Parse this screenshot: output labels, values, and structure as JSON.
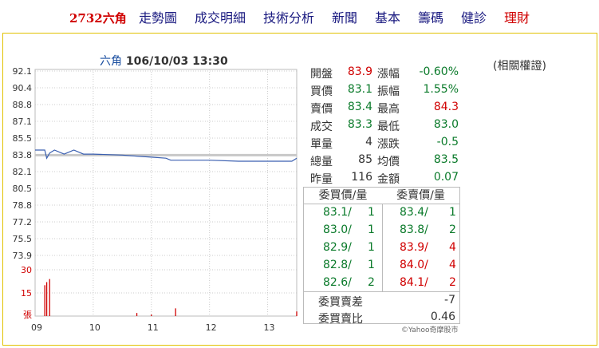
{
  "nav": {
    "stock": "2732六角",
    "items": [
      "走勢圖",
      "成交明細",
      "技術分析",
      "新聞",
      "基本",
      "籌碼",
      "健診"
    ],
    "finance": "理財"
  },
  "chart": {
    "name": "六角",
    "datetime": "106/10/03 13:30",
    "y_ticks": [
      "92.1",
      "90.4",
      "88.8",
      "87.1",
      "85.5",
      "83.8",
      "82.1",
      "80.5",
      "78.8",
      "77.2",
      "75.5",
      "73.9"
    ],
    "vol_ticks": [
      "30",
      "15",
      "張"
    ],
    "x_ticks": [
      "09",
      "10",
      "11",
      "12",
      "13"
    ]
  },
  "chart_data": {
    "type": "line",
    "x": [
      "09:00",
      "09:10",
      "09:12",
      "09:15",
      "09:20",
      "09:30",
      "09:40",
      "09:50",
      "10:00",
      "10:30",
      "10:45",
      "11:00",
      "11:15",
      "11:20",
      "11:30",
      "11:45",
      "12:00",
      "12:30",
      "13:00",
      "13:25",
      "13:30"
    ],
    "series": [
      {
        "values": [
          84.3,
          84.3,
          83.5,
          84.0,
          84.3,
          83.9,
          84.3,
          83.9,
          83.9,
          83.8,
          83.7,
          83.6,
          83.5,
          83.3,
          83.3,
          83.3,
          83.3,
          83.2,
          83.2,
          83.2,
          83.5
        ]
      }
    ],
    "reference": 83.8,
    "volume": {
      "x": [
        "09:10",
        "09:12",
        "09:15",
        "10:45",
        "11:00",
        "11:25",
        "13:30"
      ],
      "values": [
        20,
        22,
        24,
        2,
        1,
        5,
        3
      ]
    },
    "ylim": [
      73.9,
      92.1
    ]
  },
  "quote": {
    "rows": [
      {
        "l1": "開盤",
        "v1": "83.9",
        "c1": "red",
        "l2": "漲幅",
        "v2": "-0.60%",
        "c2": "green"
      },
      {
        "l1": "買價",
        "v1": "83.1",
        "c1": "green",
        "l2": "振幅",
        "v2": "1.55%",
        "c2": "green"
      },
      {
        "l1": "賣價",
        "v1": "83.4",
        "c1": "green",
        "l2": "最高",
        "v2": "84.3",
        "c2": "red"
      },
      {
        "l1": "成交",
        "v1": "83.3",
        "c1": "green",
        "l2": "最低",
        "v2": "83.0",
        "c2": "green"
      },
      {
        "l1": "單量",
        "v1": "4",
        "c1": "dark",
        "l2": "漲跌",
        "v2": "-0.5",
        "c2": "green"
      },
      {
        "l1": "總量",
        "v1": "85",
        "c1": "dark",
        "l2": "均價",
        "v2": "83.5",
        "c2": "green"
      },
      {
        "l1": "昨量",
        "v1": "116",
        "c1": "dark",
        "l2": "金額",
        "v2": "0.07",
        "c2": "green"
      }
    ]
  },
  "book": {
    "bid_header": "委買價/量",
    "ask_header": "委賣價/量",
    "rows": [
      {
        "bp": "83.1/",
        "bq": "1",
        "ap": "83.4/",
        "aq": "1",
        "bc": "green",
        "ac": "green"
      },
      {
        "bp": "83.0/",
        "bq": "1",
        "ap": "83.8/",
        "aq": "2",
        "bc": "green",
        "ac": "green"
      },
      {
        "bp": "82.9/",
        "bq": "1",
        "ap": "83.9/",
        "aq": "4",
        "bc": "green",
        "ac": "red"
      },
      {
        "bp": "82.8/",
        "bq": "1",
        "ap": "84.0/",
        "aq": "4",
        "bc": "green",
        "ac": "red"
      },
      {
        "bp": "82.6/",
        "bq": "2",
        "ap": "84.1/",
        "aq": "2",
        "bc": "green",
        "ac": "red"
      }
    ],
    "diff_label": "委買賣差",
    "diff_value": "-7",
    "ratio_label": "委買賣比",
    "ratio_value": "0.46"
  },
  "related": "(相關權證)",
  "credit": "©Yahoo奇摩股市"
}
